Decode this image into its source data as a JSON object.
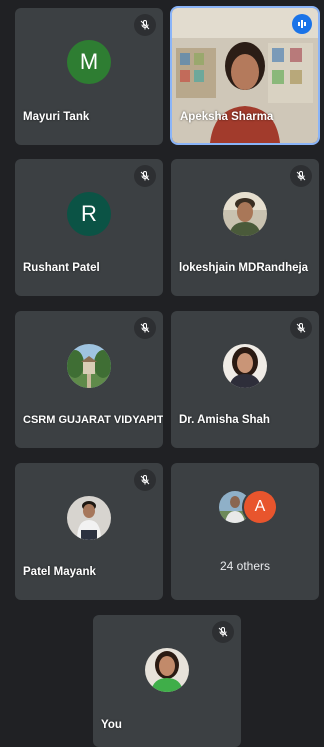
{
  "participants": [
    {
      "name": "Mayuri Tank",
      "initial": "M",
      "avatar_color": "#2e7d32",
      "muted": true
    },
    {
      "name": "Apeksha Sharma",
      "muted": false,
      "speaking": true
    },
    {
      "name": "Rushant Patel",
      "initial": "R",
      "avatar_color": "#0b5345",
      "muted": true
    },
    {
      "name": "lokeshjain MDRandheja",
      "muted": true
    },
    {
      "name": "CSRM GUJARAT VIDYAPITH",
      "muted": true
    },
    {
      "name": "Dr. Amisha Shah",
      "muted": true
    },
    {
      "name": "Patel Mayank",
      "muted": true
    },
    {
      "name": "You",
      "muted": true
    }
  ],
  "others": {
    "label": "24 others",
    "initial": "A",
    "avatar_color": "#e8552d"
  },
  "icons": {
    "muted": "mic-off-icon",
    "speaking": "audio-level-icon"
  },
  "colors": {
    "background": "#202124",
    "tile": "#3c4043",
    "active_border": "#8ab4f8"
  }
}
